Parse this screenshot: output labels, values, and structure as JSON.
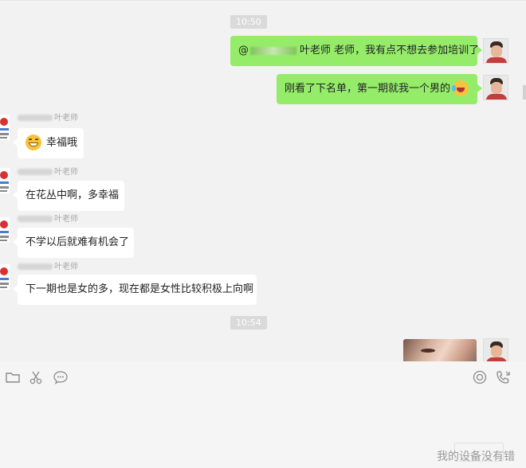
{
  "times": [
    "10:50",
    "10:54"
  ],
  "messages": {
    "m1": {
      "prefix": "@",
      "text": "叶老师 老师，我有点不想去参加培训了"
    },
    "m2": {
      "text": "刚看了下名单，第一期就我一个男的"
    },
    "m3": {
      "sender": "叶老师",
      "text": "幸福哦"
    },
    "m4": {
      "sender": "叶老师",
      "text": "在花丛中啊，多幸福"
    },
    "m5": {
      "sender": "叶老师",
      "text": "不学以后就难有机会了"
    },
    "m6": {
      "sender": "叶老师",
      "text": "下一期也是女的多，现在都是女性比较积极上向啊"
    }
  },
  "icons": {
    "grin": "grinning-face-emoji",
    "laugh": "rolling-laughing-emoji",
    "folder": "folder-icon",
    "scissors": "scissors-icon",
    "chat": "chat-bubble-icon",
    "voice": "voice-call-icon",
    "video": "phone-call-icon"
  },
  "colors": {
    "self_bubble": "#95ec69",
    "other_bubble": "#ffffff",
    "chat_bg": "#f2f2f2"
  },
  "watermark": "我的设备没有错"
}
